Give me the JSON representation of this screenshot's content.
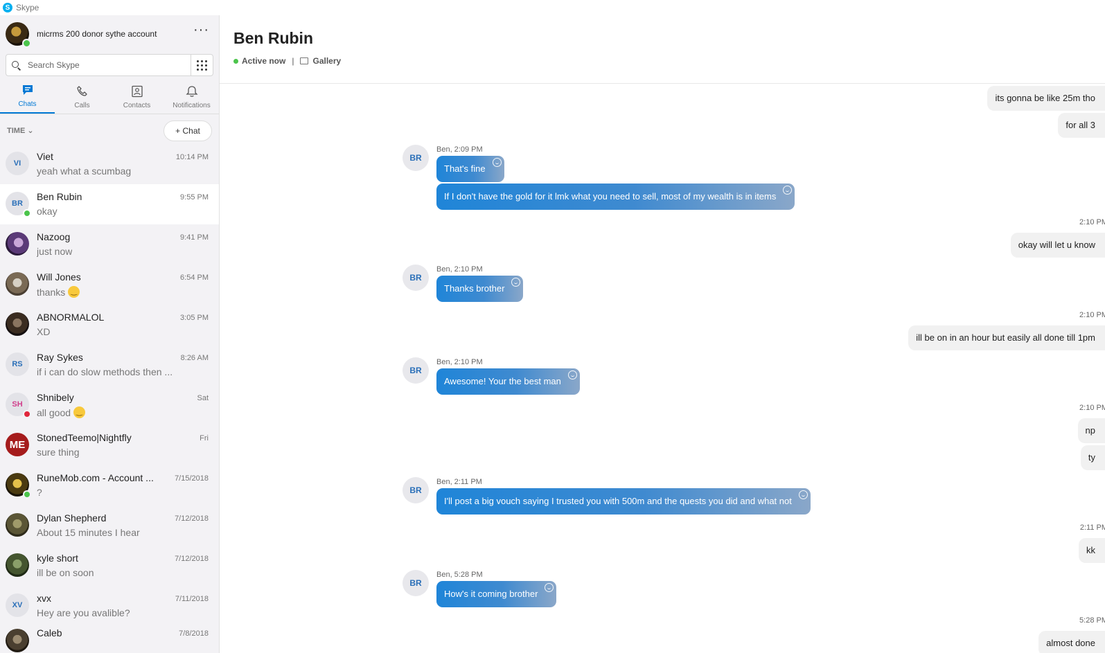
{
  "app": {
    "title": "Skype"
  },
  "profile": {
    "name": "micrms 200 donor sythe account",
    "more": "···"
  },
  "search": {
    "placeholder": "Search Skype"
  },
  "nav": {
    "chats": "Chats",
    "calls": "Calls",
    "contacts": "Contacts",
    "notifications": "Notifications"
  },
  "list_header": {
    "sort": "TIME",
    "new_chat": "+ Chat"
  },
  "chats": [
    {
      "initials": "VI",
      "name": "Viet",
      "preview": "yeah what a scumbag",
      "time": "10:14 PM",
      "initials_color": "#2a6fb8"
    },
    {
      "initials": "BR",
      "name": "Ben Rubin",
      "preview": "okay",
      "time": "9:55 PM",
      "initials_color": "#2a6fb8",
      "status": "online"
    },
    {
      "initials": "",
      "name": "Nazoog",
      "preview": "just now",
      "time": "9:41 PM"
    },
    {
      "initials": "",
      "name": "Will Jones",
      "preview": "thanks",
      "time": "6:54 PM",
      "emoji": "smile"
    },
    {
      "initials": "",
      "name": "ABNORMALOL",
      "preview": "XD",
      "time": "3:05 PM"
    },
    {
      "initials": "RS",
      "name": "Ray Sykes",
      "preview": "if i can do slow methods then ...",
      "time": "8:26 AM",
      "initials_color": "#2a6fb8"
    },
    {
      "initials": "SH",
      "name": "Shnibely",
      "preview": "all good",
      "time": "Sat",
      "initials_color": "#d13f8c",
      "status": "busy",
      "emoji": "smile"
    },
    {
      "initials": "ME",
      "name": "StonedTeemo|Nightfly",
      "preview": "sure thing",
      "time": "Fri",
      "initials_color": "#ffffff"
    },
    {
      "initials": "",
      "name": "RuneMob.com - Account ...",
      "preview": "?",
      "time": "7/15/2018",
      "status": "online"
    },
    {
      "initials": "",
      "name": "Dylan Shepherd",
      "preview": "About 15 minutes I hear",
      "time": "7/12/2018"
    },
    {
      "initials": "",
      "name": "kyle short",
      "preview": "ill be on soon",
      "time": "7/12/2018"
    },
    {
      "initials": "XV",
      "name": "xvx",
      "preview": "Hey are you avalible?",
      "time": "7/11/2018",
      "initials_color": "#2a6fb8"
    },
    {
      "initials": "",
      "name": "Caleb",
      "preview": "",
      "time": "7/8/2018"
    }
  ],
  "conversation": {
    "name": "Ben Rubin",
    "status": "Active now",
    "separator": "|",
    "gallery": "Gallery",
    "messages": [
      {
        "dir": "out",
        "text": "its gonna be like 25m tho"
      },
      {
        "dir": "out",
        "text": "for all 3"
      },
      {
        "dir": "in",
        "meta": "Ben, 2:09 PM",
        "text": "That's fine",
        "avatar": "BR"
      },
      {
        "dir": "in",
        "text": "If I don't have the gold for it lmk what you need to sell, most of my wealth is in items"
      },
      {
        "dir": "out",
        "time": "2:10 PM",
        "text": "okay will let u know"
      },
      {
        "dir": "in",
        "meta": "Ben, 2:10 PM",
        "text": "Thanks brother",
        "avatar": "BR"
      },
      {
        "dir": "out",
        "time": "2:10 PM",
        "text": "ill be on in an hour but easily all done till 1pm"
      },
      {
        "dir": "in",
        "meta": "Ben, 2:10 PM",
        "text": "Awesome! Your the best man",
        "avatar": "BR"
      },
      {
        "dir": "out",
        "time": "2:10 PM",
        "text": "np"
      },
      {
        "dir": "out",
        "text": "ty"
      },
      {
        "dir": "in",
        "meta": "Ben, 2:11 PM",
        "text": "I'll post a big vouch saying I trusted you with 500m and the quests you did and what not",
        "avatar": "BR"
      },
      {
        "dir": "out",
        "time": "2:11 PM",
        "text": "kk"
      },
      {
        "dir": "in",
        "meta": "Ben, 5:28 PM",
        "text": "How's it coming brother",
        "avatar": "BR"
      },
      {
        "dir": "out",
        "time": "5:28 PM",
        "text": "almost done"
      }
    ]
  },
  "colors": {
    "accent": "#0078d4",
    "online": "#4bc44b",
    "busy": "#e0263b",
    "bubble_in": "#1f85d8",
    "bubble_out": "#f1f1f1"
  }
}
